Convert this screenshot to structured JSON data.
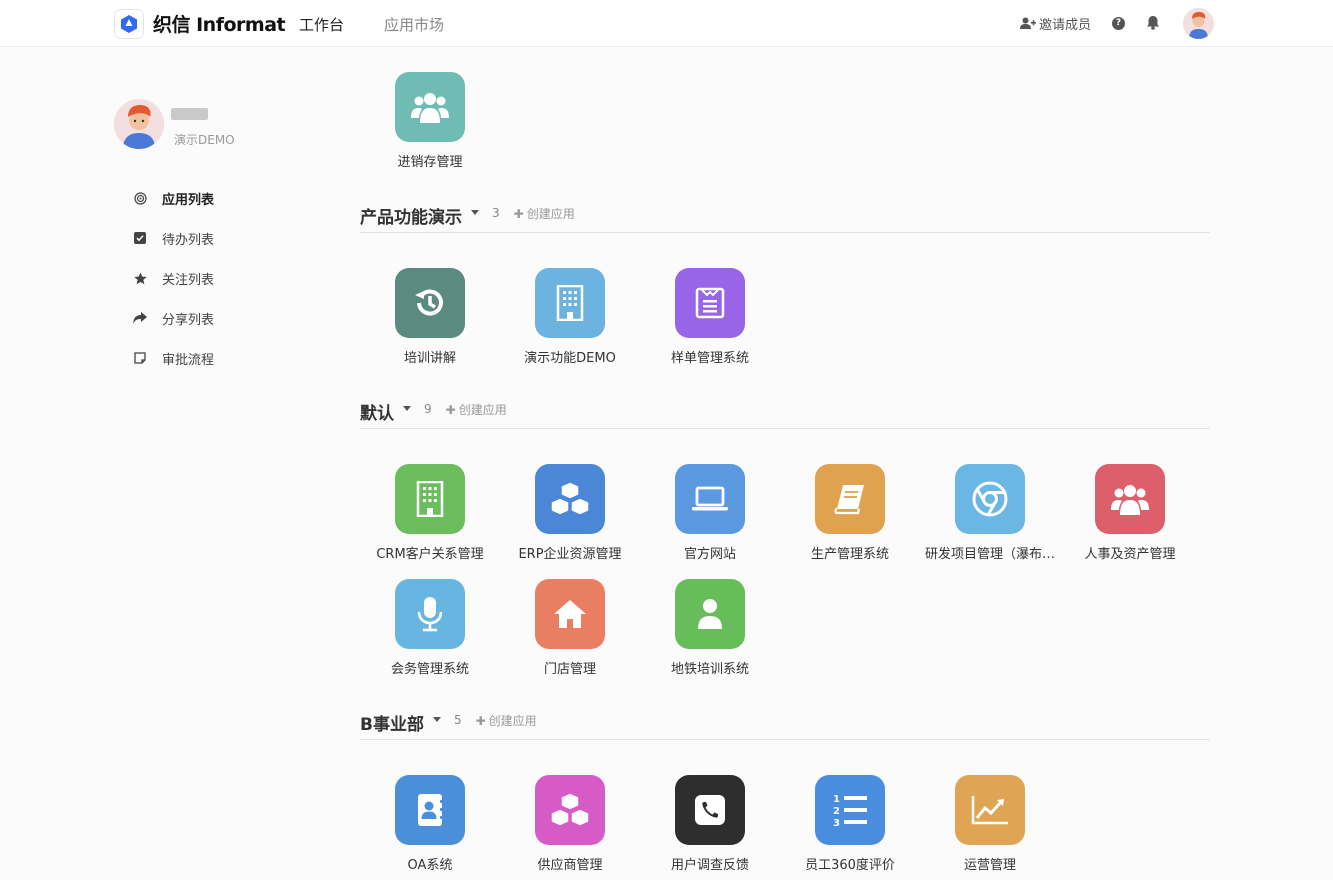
{
  "topbar": {
    "brand": "织信 Informat",
    "tabs": [
      "工作台",
      "应用市场"
    ],
    "invite_label": "邀请成员",
    "help_icon": "question-circle-icon",
    "bell_icon": "bell-icon",
    "brand_color": "#2f6bf0"
  },
  "sidebar": {
    "user_sub": "演示DEMO",
    "items": [
      {
        "label": "应用列表",
        "icon": "target-icon"
      },
      {
        "label": "待办列表",
        "icon": "checkbox-icon"
      },
      {
        "label": "关注列表",
        "icon": "star-icon"
      },
      {
        "label": "分享列表",
        "icon": "share-icon"
      },
      {
        "label": "审批流程",
        "icon": "note-icon"
      }
    ]
  },
  "sections": {
    "top_app": {
      "label": "进销存管理",
      "color": "#6fbcb4",
      "icon": "users-icon"
    },
    "s1": {
      "title": "产品功能演示",
      "count": "3",
      "create_label": "创建应用",
      "apps": [
        {
          "label": "培训讲解",
          "color": "#5a8a80",
          "icon": "history-icon"
        },
        {
          "label": "演示功能DEMO",
          "color": "#6db3e0",
          "icon": "building-icon"
        },
        {
          "label": "样单管理系统",
          "color": "#9865e8",
          "icon": "list-card-icon"
        }
      ]
    },
    "s2": {
      "title": "默认",
      "count": "9",
      "create_label": "创建应用",
      "apps": [
        {
          "label": "CRM客户关系管理",
          "color": "#6bbd5d",
          "icon": "building-icon"
        },
        {
          "label": "ERP企业资源管理",
          "color": "#4b87d6",
          "icon": "cubes-icon"
        },
        {
          "label": "官方网站",
          "color": "#5b9ae0",
          "icon": "laptop-icon"
        },
        {
          "label": "生产管理系统",
          "color": "#e0a24e",
          "icon": "book-icon"
        },
        {
          "label": "研发项目管理（瀑布…",
          "color": "#6ab7e3",
          "icon": "chrome-icon"
        },
        {
          "label": "人事及资产管理",
          "color": "#dd5f6c",
          "icon": "users-icon"
        },
        {
          "label": "会务管理系统",
          "color": "#67b6e2",
          "icon": "microphone-icon"
        },
        {
          "label": "门店管理",
          "color": "#ea7e62",
          "icon": "home-icon"
        },
        {
          "label": "地铁培训系统",
          "color": "#66bd59",
          "icon": "user-icon"
        }
      ]
    },
    "s3": {
      "title": "B事业部",
      "count": "5",
      "create_label": "创建应用",
      "apps": [
        {
          "label": "OA系统",
          "color": "#4b8ed9",
          "icon": "contacts-book-icon"
        },
        {
          "label": "供应商管理",
          "color": "#d75bc6",
          "icon": "cubes-icon"
        },
        {
          "label": "用户调查反馈",
          "color": "#2e2e2e",
          "icon": "phone-icon"
        },
        {
          "label": "员工360度评价",
          "color": "#4a8cde",
          "icon": "ordered-list-icon"
        },
        {
          "label": "运营管理",
          "color": "#dfa555",
          "icon": "line-chart-icon"
        }
      ]
    }
  }
}
